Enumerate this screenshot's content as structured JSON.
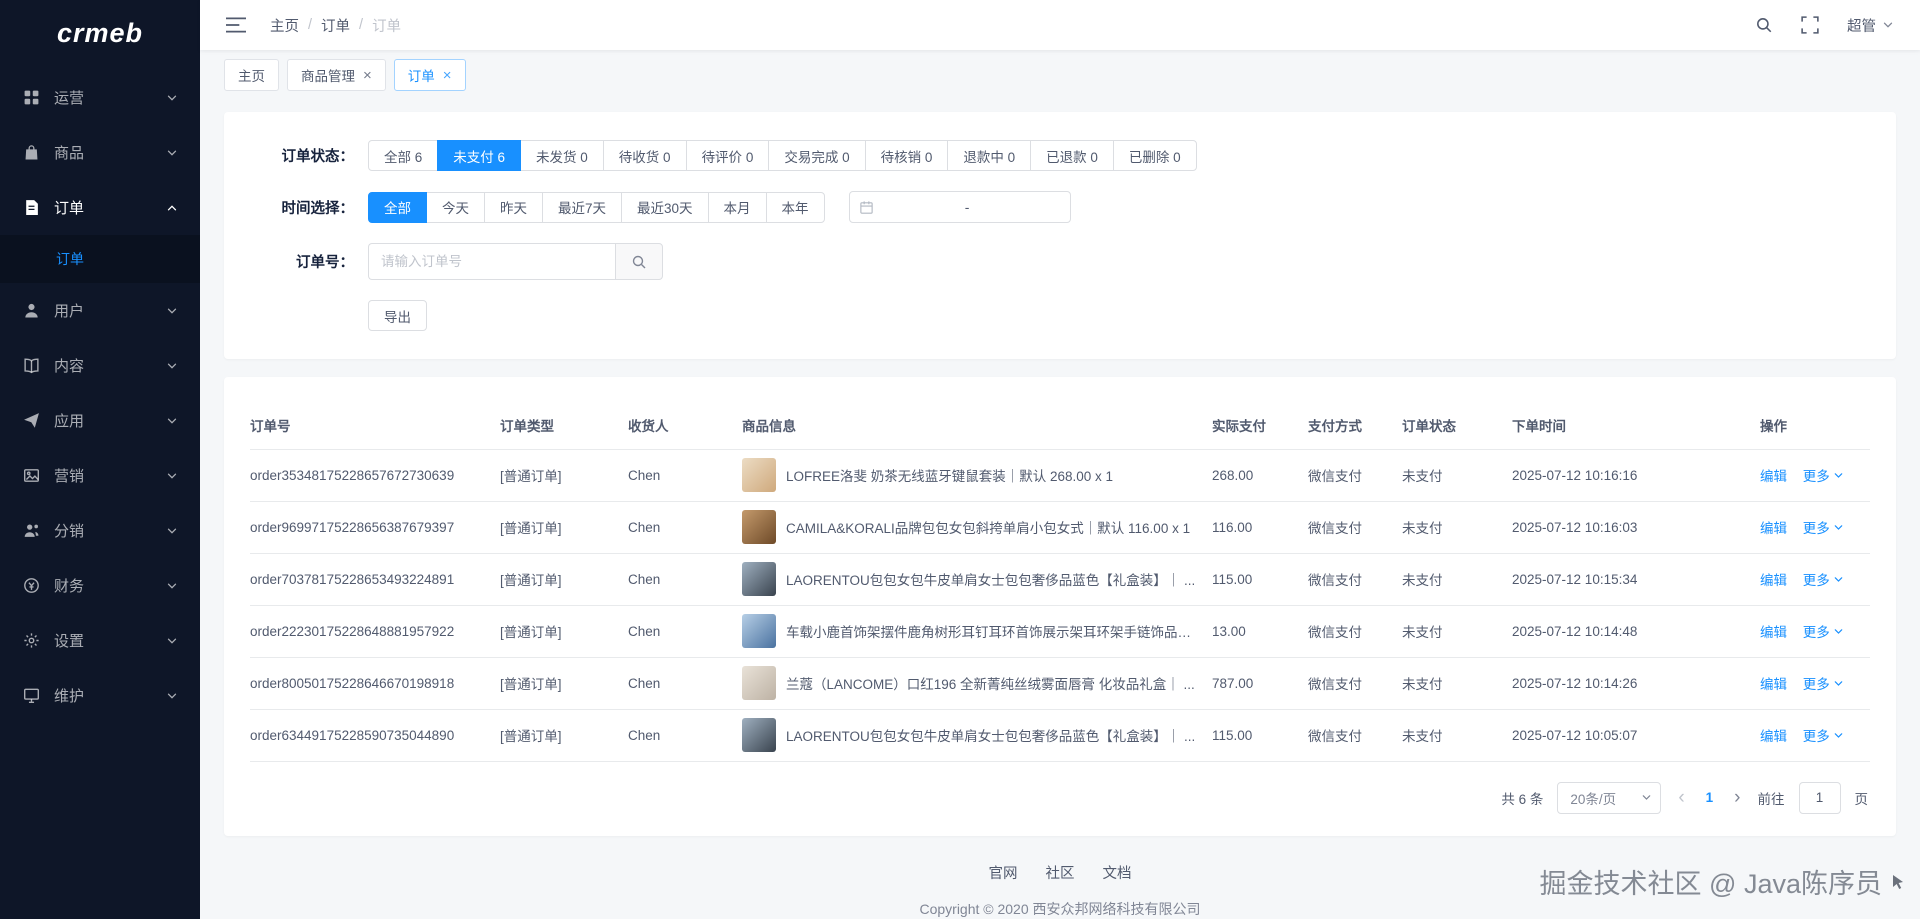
{
  "colors": {
    "accent": "#1890ff",
    "sidebar_bg": "#0e1628"
  },
  "brand": {
    "logo": "crmeb"
  },
  "header": {
    "breadcrumb": [
      "主页",
      "订单",
      "订单"
    ],
    "user": "超管"
  },
  "tabs": [
    {
      "label": "主页",
      "closable": false,
      "active": false
    },
    {
      "label": "商品管理",
      "closable": true,
      "active": false
    },
    {
      "label": "订单",
      "closable": true,
      "active": true
    }
  ],
  "sidebar": {
    "items": [
      {
        "label": "运营",
        "icon": "dashboard-icon",
        "expanded": false
      },
      {
        "label": "商品",
        "icon": "product-icon",
        "expanded": false
      },
      {
        "label": "订单",
        "icon": "order-icon",
        "expanded": true,
        "children": [
          {
            "label": "订单",
            "active": true
          }
        ]
      },
      {
        "label": "用户",
        "icon": "user-icon",
        "expanded": false
      },
      {
        "label": "内容",
        "icon": "content-icon",
        "expanded": false
      },
      {
        "label": "应用",
        "icon": "app-icon",
        "expanded": false
      },
      {
        "label": "营销",
        "icon": "marketing-icon",
        "expanded": false
      },
      {
        "label": "分销",
        "icon": "distribution-icon",
        "expanded": false
      },
      {
        "label": "财务",
        "icon": "finance-icon",
        "expanded": false
      },
      {
        "label": "设置",
        "icon": "settings-icon",
        "expanded": false
      },
      {
        "label": "维护",
        "icon": "maintenance-icon",
        "expanded": false
      }
    ]
  },
  "filters": {
    "status_label": "订单状态：",
    "status_options": [
      {
        "label": "全部 6",
        "active": false
      },
      {
        "label": "未支付 6",
        "active": true
      },
      {
        "label": "未发货 0",
        "active": false
      },
      {
        "label": "待收货 0",
        "active": false
      },
      {
        "label": "待评价 0",
        "active": false
      },
      {
        "label": "交易完成 0",
        "active": false
      },
      {
        "label": "待核销 0",
        "active": false
      },
      {
        "label": "退款中 0",
        "active": false
      },
      {
        "label": "已退款 0",
        "active": false
      },
      {
        "label": "已删除 0",
        "active": false
      }
    ],
    "time_label": "时间选择：",
    "time_options": [
      {
        "label": "全部",
        "active": true
      },
      {
        "label": "今天",
        "active": false
      },
      {
        "label": "昨天",
        "active": false
      },
      {
        "label": "最近7天",
        "active": false
      },
      {
        "label": "最近30天",
        "active": false
      },
      {
        "label": "本月",
        "active": false
      },
      {
        "label": "本年",
        "active": false
      }
    ],
    "date_separator": "-",
    "order_label": "订单号：",
    "order_placeholder": "请输入订单号",
    "export_label": "导出"
  },
  "table": {
    "columns": [
      "订单号",
      "订单类型",
      "收货人",
      "商品信息",
      "实际支付",
      "支付方式",
      "订单状态",
      "下单时间",
      "操作"
    ],
    "edit_label": "编辑",
    "more_label": "更多",
    "rows": [
      {
        "order_no": "order35348175228657672730639",
        "order_type": "[普通订单]",
        "consignee": "Chen",
        "product": "LOFREE洛斐 奶茶无线蓝牙键鼠套装｜默认  268.00 x 1",
        "thumb_colors": [
          "#ecdcc4",
          "#cfa97c"
        ],
        "paid": "268.00",
        "pay_method": "微信支付",
        "status": "未支付",
        "time": "2025-07-12 10:16:16"
      },
      {
        "order_no": "order96997175228656387679397",
        "order_type": "[普通订单]",
        "consignee": "Chen",
        "product": "CAMILA&KORALI品牌包包女包斜挎单肩小包女式｜默认  116.00 x 1",
        "thumb_colors": [
          "#c49a6c",
          "#6e4a28"
        ],
        "paid": "116.00",
        "pay_method": "微信支付",
        "status": "未支付",
        "time": "2025-07-12 10:16:03"
      },
      {
        "order_no": "order70378175228653493224891",
        "order_type": "[普通订单]",
        "consignee": "Chen",
        "product": "LAORENTOU包包女包牛皮单肩女士包包奢侈品蓝色【礼盒装】｜ ...",
        "thumb_colors": [
          "#9fb0c0",
          "#39434e"
        ],
        "paid": "115.00",
        "pay_method": "微信支付",
        "status": "未支付",
        "time": "2025-07-12 10:15:34"
      },
      {
        "order_no": "order22230175228648881957922",
        "order_type": "[普通订单]",
        "consignee": "Chen",
        "product": "车载小鹿首饰架摆件鹿角树形耳钉耳环首饰展示架耳环架手链饰品收纳...",
        "thumb_colors": [
          "#b7cfe6",
          "#4a72a0"
        ],
        "paid": "13.00",
        "pay_method": "微信支付",
        "status": "未支付",
        "time": "2025-07-12 10:14:48"
      },
      {
        "order_no": "order80050175228646670198918",
        "order_type": "[普通订单]",
        "consignee": "Chen",
        "product": "兰蔻（LANCOME）口红196 全新菁纯丝绒雾面唇膏 化妆品礼盒｜ ...",
        "thumb_colors": [
          "#e9e2d8",
          "#bdb2a4"
        ],
        "paid": "787.00",
        "pay_method": "微信支付",
        "status": "未支付",
        "time": "2025-07-12 10:14:26"
      },
      {
        "order_no": "order63449175228590735044890",
        "order_type": "[普通订单]",
        "consignee": "Chen",
        "product": "LAORENTOU包包女包牛皮单肩女士包包奢侈品蓝色【礼盒装】｜ ...",
        "thumb_colors": [
          "#9fb0c0",
          "#39434e"
        ],
        "paid": "115.00",
        "pay_method": "微信支付",
        "status": "未支付",
        "time": "2025-07-12 10:05:07"
      }
    ]
  },
  "pagination": {
    "total": "共 6 条",
    "page_size": "20条/页",
    "current": "1",
    "goto_label": "前往",
    "goto_value": "1",
    "unit": "页"
  },
  "footer": {
    "links": [
      "官网",
      "社区",
      "文档"
    ],
    "copyright": "Copyright © 2020 西安众邦网络科技有限公司"
  },
  "watermark": {
    "text": "掘金技术社区 @ Java陈序员"
  }
}
